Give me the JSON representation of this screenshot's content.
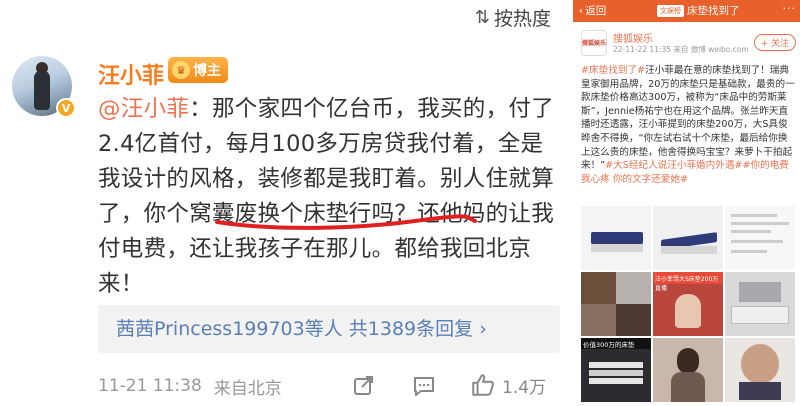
{
  "left": {
    "sort_label": "按热度",
    "sort_icon": "sort-swap-icon",
    "user": {
      "name": "汪小菲",
      "vip_label": "博主",
      "verified_icon": "verified-badge-icon"
    },
    "comment": {
      "mention": "@汪小菲",
      "text": "：那个家四个亿台币，我买的，付了2.4亿首付，每月100多万房贷我付着，全是我设计的风格，装修都是我盯着。别人住就算了，你个窝囊废换个床垫行吗？还他妈的让我付电费，还让我孩子在那儿。都给我回北京来！"
    },
    "replies": {
      "user": "茜茜Princess199703",
      "text": "等人 ",
      "count_text": "共1389条回复",
      "arrow": "›"
    },
    "meta": {
      "time": "11-21 11:38",
      "location": "来自北京",
      "likes": "1.4万"
    }
  },
  "right": {
    "nav": {
      "back_label": "返回",
      "title": "床垫找到了",
      "title_tag": "文娱榜"
    },
    "source": {
      "logo_text": "搜狐娱乐",
      "name": "搜狐娱乐",
      "time": "22-11-22 11:35 来自 微博 weibo.com",
      "follow_label": "+ 关注"
    },
    "post": {
      "hashtag1": "#床垫找到了#",
      "body": "汪小菲最在意的床垫找到了！瑞典皇家御用品牌，20万的床垫只是基础款，最贵的一款床垫价格高达300万，被称为“床品中的劳斯莱斯”，Jennie杨祐宁也在用这个品牌。张兰昨天直播时还透露，汪小菲提到的床垫200万，大S具俊晔舍不得换，“你左试右试十个床垫，最后给你换上这么贵的床垫，他舍得换吗宝宝？来萝卜干拍起来！”",
      "hashtag2": "#大S经纪人说汪小菲婚内外遇#",
      "hashtag3": "#你的电费我心疼 你的文字还爱她#"
    },
    "images": {
      "cap_price": "价值300万的床垫",
      "cap_live": "汪小菲骂大S床垫200万直播"
    }
  },
  "colors": {
    "accent": "#eb7350",
    "username": "#f77c1e",
    "link": "#5a7fb5",
    "underline_red": "#e02020",
    "nav_bar": "#e8602b"
  }
}
